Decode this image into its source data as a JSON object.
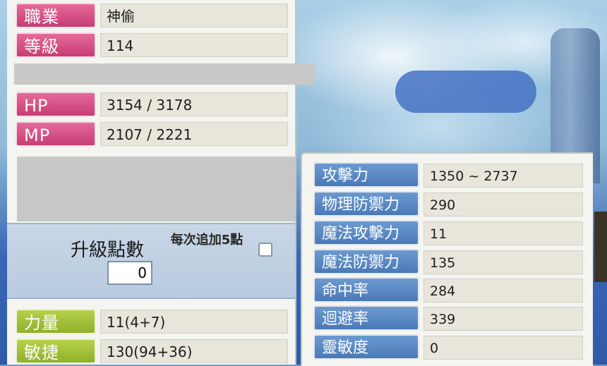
{
  "left": {
    "job": {
      "label": "職業",
      "value": "神偷"
    },
    "level": {
      "label": "等級",
      "value": "114"
    },
    "hp": {
      "label": "HP",
      "value": "3154 / 3178"
    },
    "mp": {
      "label": "MP",
      "value": "2107 / 2221"
    },
    "level_up": {
      "title": "升級點數",
      "points": "0",
      "auto_add": "每次追加5點"
    },
    "str": {
      "label": "力量",
      "value": "11(4+7)"
    },
    "dex": {
      "label": "敏捷",
      "value": "130(94+36)"
    }
  },
  "stats": [
    {
      "label": "攻擊力",
      "value": "1350 ~ 2737"
    },
    {
      "label": "物理防禦力",
      "value": "290"
    },
    {
      "label": "魔法攻擊力",
      "value": "11"
    },
    {
      "label": "魔法防禦力",
      "value": "135"
    },
    {
      "label": "命中率",
      "value": "284"
    },
    {
      "label": "迴避率",
      "value": "339"
    },
    {
      "label": "靈敏度",
      "value": "0"
    }
  ]
}
